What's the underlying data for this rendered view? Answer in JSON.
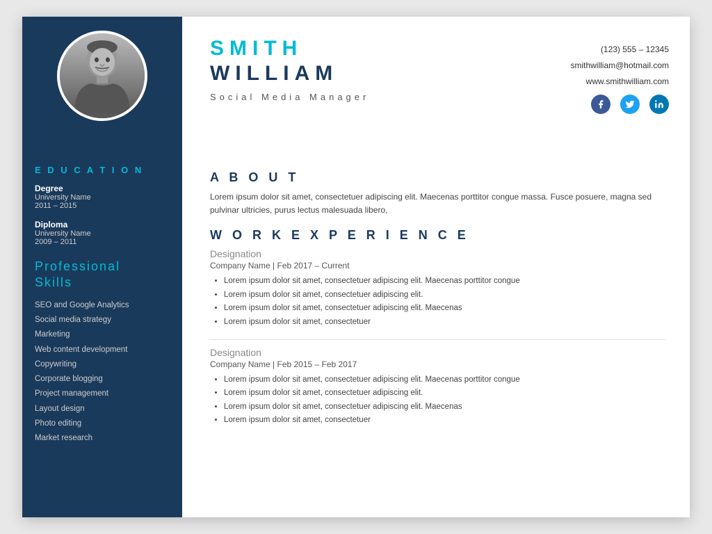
{
  "header": {
    "name_first": "SMITH",
    "name_last": "WILLIAM",
    "job_title": "Social  Media  Manager",
    "phone": "(123) 555 – 12345",
    "email": "smithwilliam@hotmail.com",
    "website": "www.smithwilliam.com"
  },
  "social": {
    "facebook_label": "f",
    "twitter_label": "t",
    "linkedin_label": "in"
  },
  "sidebar": {
    "education_title": "E D U C A T I O N",
    "education_items": [
      {
        "degree": "Degree",
        "university": "University Name",
        "years": "2011 – 2015"
      },
      {
        "degree": "Diploma",
        "university": "University Name",
        "years": "2009 – 2011"
      }
    ],
    "skills_title": "Professional\nSkills",
    "skills": [
      "SEO and Google Analytics",
      "Social media strategy",
      "Marketing",
      "Web content development",
      "Copywriting",
      "Corporate blogging",
      "Project management",
      "Layout design",
      "Photo editing",
      "Market research"
    ]
  },
  "about": {
    "title": "A B O U T",
    "text": "Lorem ipsum dolor sit amet, consectetuer adipiscing elit. Maecenas porttitor congue massa. Fusce posuere, magna sed pulvinar ultricies, purus lectus malesuada libero,"
  },
  "work_experience": {
    "title": "W O R K  E X P E R I E N C E",
    "jobs": [
      {
        "designation": "Designation",
        "company": "Company Name | Feb 2017 – Current",
        "bullets": [
          "Lorem ipsum dolor sit amet, consectetuer adipiscing elit. Maecenas porttitor congue",
          "Lorem ipsum dolor sit amet, consectetuer adipiscing elit.",
          "Lorem ipsum dolor sit amet, consectetuer adipiscing elit. Maecenas",
          "Lorem ipsum dolor sit amet, consectetuer"
        ]
      },
      {
        "designation": "Designation",
        "company": "Company Name | Feb 2015 – Feb 2017",
        "bullets": [
          "Lorem ipsum dolor sit amet, consectetuer adipiscing elit. Maecenas porttitor congue",
          "Lorem ipsum dolor sit amet, consectetuer adipiscing elit.",
          "Lorem ipsum dolor sit amet, consectetuer adipiscing elit. Maecenas",
          "Lorem ipsum dolor sit amet, consectetuer"
        ]
      }
    ]
  }
}
